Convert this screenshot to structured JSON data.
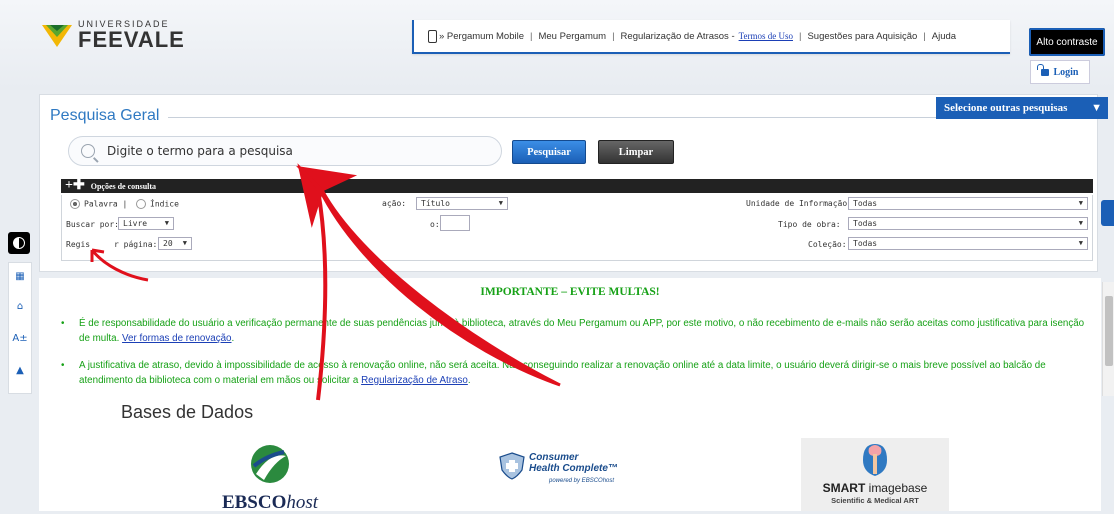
{
  "header": {
    "logo_small": "UNIVERSIDADE",
    "logo_big": "FEEVALE",
    "nav": [
      {
        "label": "» Pergamum Mobile"
      },
      {
        "label": "Meu Pergamum"
      },
      {
        "label": "Regularização de Atrasos -"
      },
      {
        "label": "Sugestões para Aquisição"
      },
      {
        "label": "Ajuda"
      }
    ],
    "terms_link": "Termos de Uso",
    "contrast_label": "Alto contraste",
    "login_label": "Login"
  },
  "search": {
    "title": "Pesquisa Geral",
    "other_searches": "Selecione outras pesquisas",
    "placeholder": "Digite o termo para a pesquisa",
    "search_btn": "Pesquisar",
    "clear_btn": "Limpar",
    "options_title": "Opções de consulta",
    "radio_palavra": "Palavra",
    "radio_indice": "Índice",
    "campo_label": "ação:",
    "campo_value": "Título",
    "buscar_label": "Buscar por:",
    "buscar_value": "Livre",
    "ano_label": "o:",
    "registros_label": "Regis",
    "registros_label2": "r página:",
    "registros_value": "20",
    "unidade_label": "Unidade de Informação:",
    "unidade_value": "Todas",
    "tipo_label": "Tipo de obra:",
    "tipo_value": "Todas",
    "colecao_label": "Coleção:",
    "colecao_value": "Todas"
  },
  "notice": {
    "title": "IMPORTANTE – EVITE MULTAS!",
    "b1_part1": "É de responsabilidade do usuário a verificação permanente de suas pendências junto à biblioteca, através do Meu Pergamum ou APP, por este motivo, o não recebimento de e-mails não serão aceitas como justificativa para isenção de multa.",
    "b1_link": "Ver formas de renovação",
    "b2_part1": "A justificativa de atraso, devido à impossibilidade de acesso à renovação online, não será aceita. Não conseguindo realizar a renovação online até a data limite, o usuário deverá dirigir-se o mais breve possível ao balcão de atendimento da biblioteca com o material em mãos ou solicitar a",
    "b2_link": "Regularização de Atraso"
  },
  "bases": {
    "title": "Bases de Dados",
    "ebsco_main": "EBSCO",
    "ebsco_host": "host",
    "consumer_line1": "Consumer",
    "consumer_line2": "Health Complete™",
    "consumer_sub": "powered by EBSCOhost",
    "smart_main": "SMART",
    "smart_rest": " imagebase",
    "smart_sub": "Scientific & Medical ART"
  },
  "colors": {
    "primary": "#1b5fb6",
    "notice_green": "#16a116",
    "annotation_red": "#e0101c"
  }
}
